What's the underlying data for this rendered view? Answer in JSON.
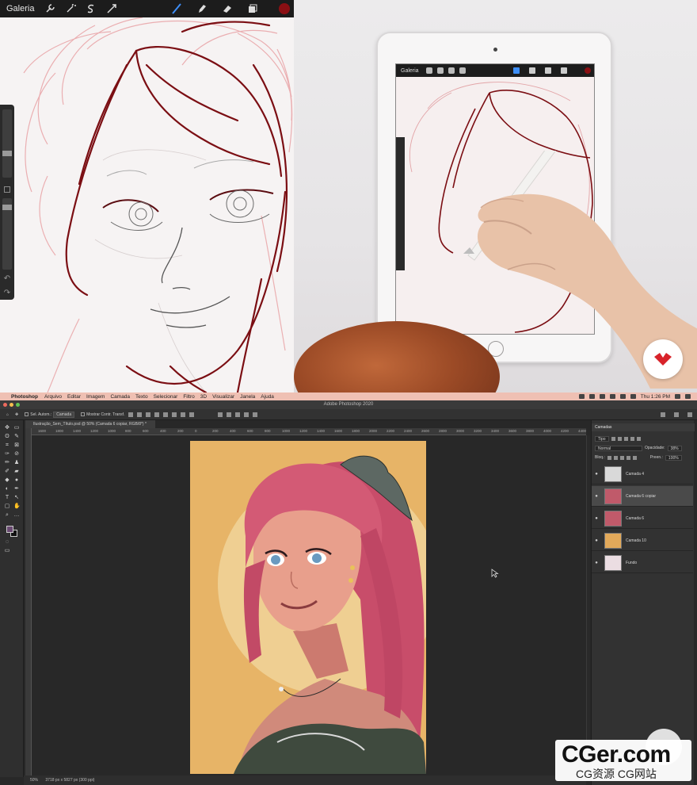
{
  "procreate": {
    "gallery_label": "Galeria",
    "brush_color": "#8a0f13",
    "tools_left": [
      "wrench-icon",
      "magic-wand-icon",
      "selection-icon",
      "transform-icon"
    ],
    "tools_right": [
      "brush-icon",
      "smudge-icon",
      "eraser-icon",
      "layers-icon",
      "color-swatch"
    ]
  },
  "ipad": {
    "gallery_label": "Galeria"
  },
  "mac_menubar": {
    "app": "Photoshop",
    "menus": [
      "Arquivo",
      "Editar",
      "Imagem",
      "Camada",
      "Texto",
      "Selecionar",
      "Filtro",
      "3D",
      "Visualizar",
      "Janela",
      "Ajuda"
    ],
    "clock": "Thu 1:26 PM"
  },
  "photoshop": {
    "window_title": "Adobe Photoshop 2020",
    "options": {
      "auto_select_label": "Sel. Autom.:",
      "auto_select_value": "Camada",
      "show_transform_label": "Mostrar Contr. Transf."
    },
    "document_tab": "Ilustração_Sem_Título.psd @ 50% (Camada 6 copiar, RGB/8*) *",
    "ruler_ticks": [
      "1600",
      "1800",
      "1400",
      "1200",
      "1000",
      "800",
      "600",
      "400",
      "200",
      "0",
      "200",
      "400",
      "600",
      "800",
      "1000",
      "1200",
      "1400",
      "1600",
      "1800",
      "2000",
      "2200",
      "2400",
      "2600",
      "2800",
      "3000",
      "3200",
      "3400",
      "3600",
      "3800",
      "4000",
      "4200",
      "4400"
    ],
    "status": {
      "zoom": "50%",
      "doc_size": "3718 px x 5827 px (300 ppi)"
    },
    "canvas_bg": "#e7b467"
  },
  "layers_panel": {
    "tab": "Camadas",
    "filter_value": "Tipo",
    "blend_mode": "Normal",
    "opacity_label": "Opacidade:",
    "opacity_value": "38%",
    "lock_label": "Bloq.:",
    "fill_label": "Preen.:",
    "fill_value": "100%",
    "layers": [
      {
        "name": "Camada 4",
        "thumb": "#d9d9d9",
        "selected": false
      },
      {
        "name": "Camada 6 copiar",
        "thumb": "#c05a6a",
        "selected": true
      },
      {
        "name": "Camada 6",
        "thumb": "#c05a6a",
        "selected": false
      },
      {
        "name": "Camada 10",
        "thumb": "#e2a95a",
        "selected": false
      },
      {
        "name": "Fundo",
        "thumb": "#ebdde2",
        "selected": false
      }
    ]
  },
  "watermark": {
    "title": "CGer.com",
    "subtitle": "CG资源  CG网站"
  }
}
